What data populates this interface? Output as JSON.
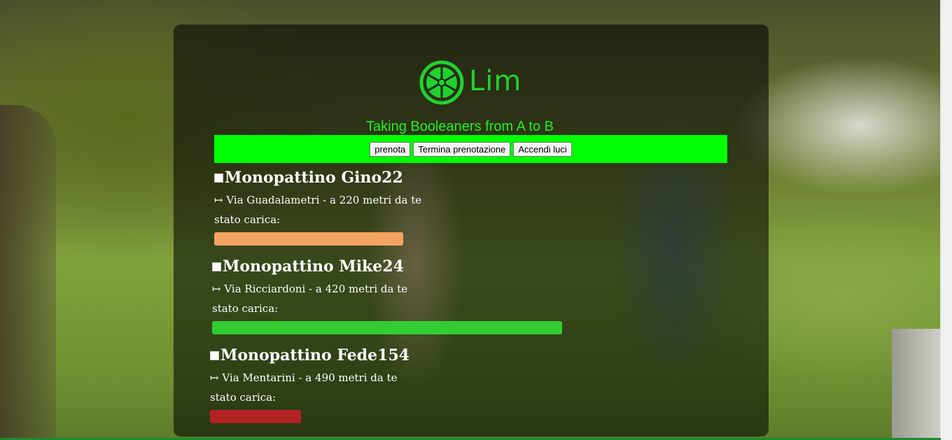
{
  "header": {
    "brand": "Lim",
    "tagline": "Taking Booleaners from A to B"
  },
  "toolbar": {
    "buttons": [
      "prenota",
      "Termina prenotazione",
      "Accendi luci"
    ]
  },
  "scooters": [
    {
      "name": "Monopattino Gino22",
      "address": "↦ Via Guadalametri - a 220 metri da te",
      "status_label": "stato carica:",
      "charge_percent": 54,
      "color": "#f4a460"
    },
    {
      "name": "Monopattino Mike24",
      "address": "↦ Via Ricciardoni - a 420 metri da te",
      "status_label": "stato carica:",
      "charge_percent": 100,
      "color": "#32cd32"
    },
    {
      "name": "Monopattino Fede154",
      "address": "↦ Via Mentarini - a 490 metri da te",
      "status_label": "stato carica:",
      "charge_percent": 26,
      "color": "#b22222"
    }
  ],
  "colors": {
    "accent": "#00ff00",
    "brand": "#22d12e"
  }
}
